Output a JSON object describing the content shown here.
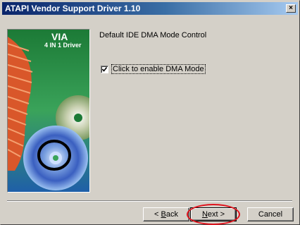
{
  "window": {
    "title": "ATAPI Vendor Support Driver 1.10",
    "close_symbol": "×"
  },
  "banner": {
    "brand": "VIA",
    "tagline": "4 IN 1 Driver"
  },
  "content": {
    "heading": "Default IDE DMA Mode Control",
    "checkbox_label": "Click to enable DMA Mode",
    "checkbox_checked": true
  },
  "buttons": {
    "back_mnemonic": "B",
    "back_rest": "ack",
    "back_prefix": "< ",
    "next_mnemonic": "N",
    "next_rest": "ext >",
    "cancel": "Cancel"
  },
  "colors": {
    "highlight_ring": "#e0141e",
    "banner_green": "#1f7a3a"
  }
}
